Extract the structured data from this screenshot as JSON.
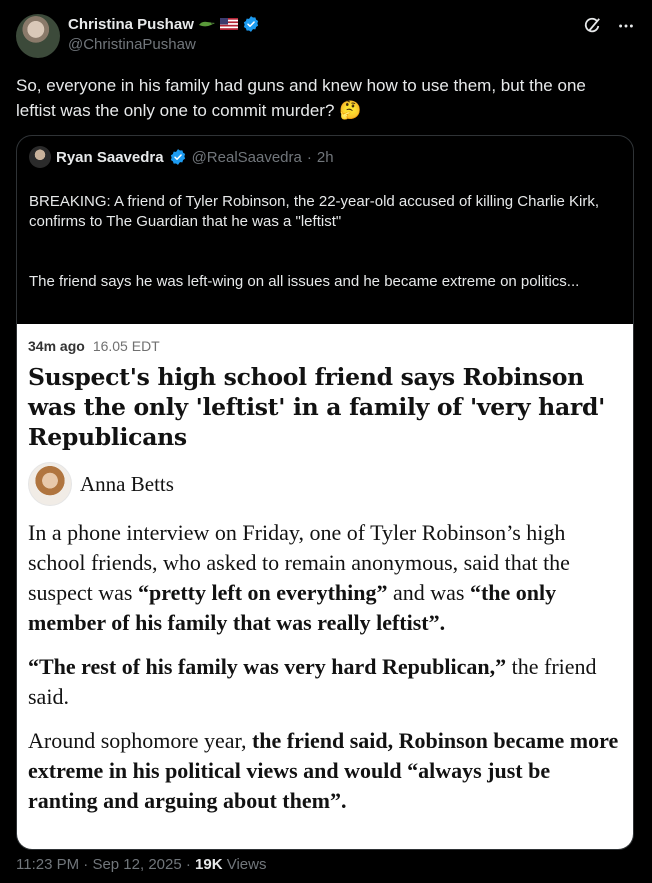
{
  "author": {
    "display_name": "Christina Pushaw",
    "handle": "@ChristinaPushaw",
    "avatar_icon": "profile-photo",
    "emoji_icons": [
      "crocodile-emoji",
      "us-flag-emoji"
    ],
    "verified_color": "#1d9bf0"
  },
  "header_actions": [
    "grok-icon",
    "more-icon"
  ],
  "tweet": {
    "text": "So, everyone in his family had guns and knew how to use them, but the one leftist was the only one to commit murder?",
    "emoji": "🤔"
  },
  "quote": {
    "display_name": "Ryan Saavedra",
    "handle": "@RealSaavedra",
    "separator": "·",
    "time": "2h",
    "paragraph_1": "BREAKING: A friend of Tyler Robinson, the 22-year-old accused of killing Charlie Kirk, confirms to The Guardian that he was a \"leftist\"",
    "paragraph_2": "The friend says he was left-wing on all issues and he became extreme on politics..."
  },
  "article": {
    "ago": "34m ago",
    "time": "16.05 EDT",
    "headline": "Suspect's high school friend says Robinson was the only 'leftist' in a family of 'very hard' Republicans",
    "byline": "Anna Betts",
    "p1_a": "In a phone interview on Friday, one of Tyler Robinson’s high school friends, who asked to remain anonymous, said that the suspect was ",
    "p1_b": "“pretty left on everything”",
    "p1_c": " and was ",
    "p1_d": "“the only member of his family that was really leftist”.",
    "p2_a": "“The rest of his family was very hard Republican,”",
    "p2_b": " the friend said.",
    "p3_a": "Around sophomore year, ",
    "p3_b": "the friend said, Robinson became more extreme in his political views and would “always just be ranting and arguing about them”."
  },
  "footer": {
    "time": "11:23 PM",
    "sep1": " · ",
    "date": "Sep 12, 2025",
    "sep2": " · ",
    "views_count": "19K",
    "views_label": " Views"
  },
  "colors": {
    "background": "#000000",
    "text": "#e7e9ea",
    "muted": "#71767b",
    "border": "#2f3336",
    "verified": "#1d9bf0"
  }
}
